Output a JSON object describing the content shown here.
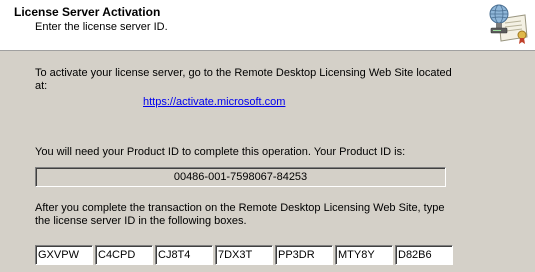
{
  "header": {
    "title": "License Server Activation",
    "subtitle": "Enter the license server ID.",
    "icon": "license-server-certificate-icon"
  },
  "instructions": {
    "activate_line1": "To activate your license server, go to the Remote Desktop Licensing Web Site located",
    "activate_line2": "at:",
    "activation_url": "https://activate.microsoft.com",
    "product_id_text": "You will need your Product ID to complete this operation. Your Product ID is:",
    "product_id": "00486-001-7598067-84253",
    "after_line1": "After you complete the transaction on the Remote Desktop Licensing Web Site, type",
    "after_line2": "the license server ID in the following boxes."
  },
  "license_server_id": [
    "GXVPW",
    "C4CPD",
    "CJ8T4",
    "7DX3T",
    "PP3DR",
    "MTY8Y",
    "D82B6"
  ]
}
